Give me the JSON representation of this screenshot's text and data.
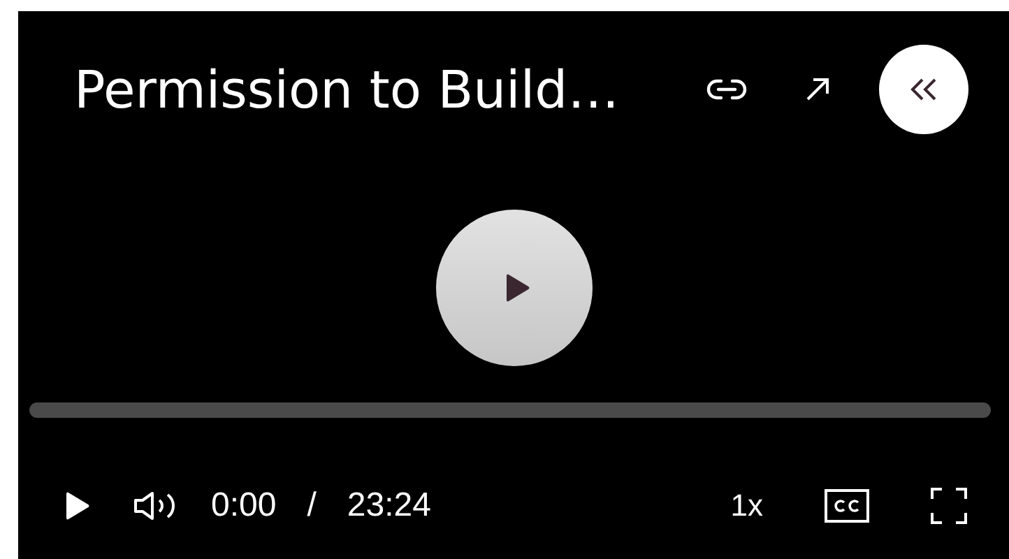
{
  "player": {
    "title": "Permission to Build…",
    "playing": false,
    "progress": {
      "level": 0
    },
    "current_time": "0:00",
    "separator": "/",
    "duration": "23:24",
    "speed": "1x"
  }
}
